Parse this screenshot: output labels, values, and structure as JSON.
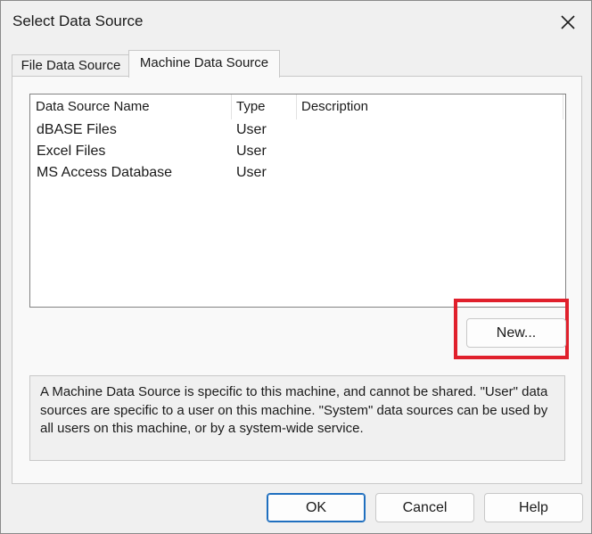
{
  "window": {
    "title": "Select Data Source",
    "close_icon": "close-icon"
  },
  "tabs": [
    {
      "label": "File Data Source",
      "active": false
    },
    {
      "label": "Machine Data Source",
      "active": true
    }
  ],
  "list": {
    "columns": [
      "Data Source Name",
      "Type",
      "Description"
    ],
    "rows": [
      {
        "name": "dBASE Files",
        "type": "User",
        "description": ""
      },
      {
        "name": "Excel Files",
        "type": "User",
        "description": ""
      },
      {
        "name": "MS Access Database",
        "type": "User",
        "description": ""
      }
    ]
  },
  "new_button": {
    "label": "New..."
  },
  "info_text": "A Machine Data Source is specific to this machine, and cannot be shared.  \"User\" data sources are specific to a user on this machine.  \"System\" data sources can be used by all users on this machine, or by a system-wide service.",
  "footer": {
    "ok_label": "OK",
    "cancel_label": "Cancel",
    "help_label": "Help"
  },
  "colors": {
    "highlight": "#e0202c",
    "default_button_border": "#1f6fbf"
  }
}
